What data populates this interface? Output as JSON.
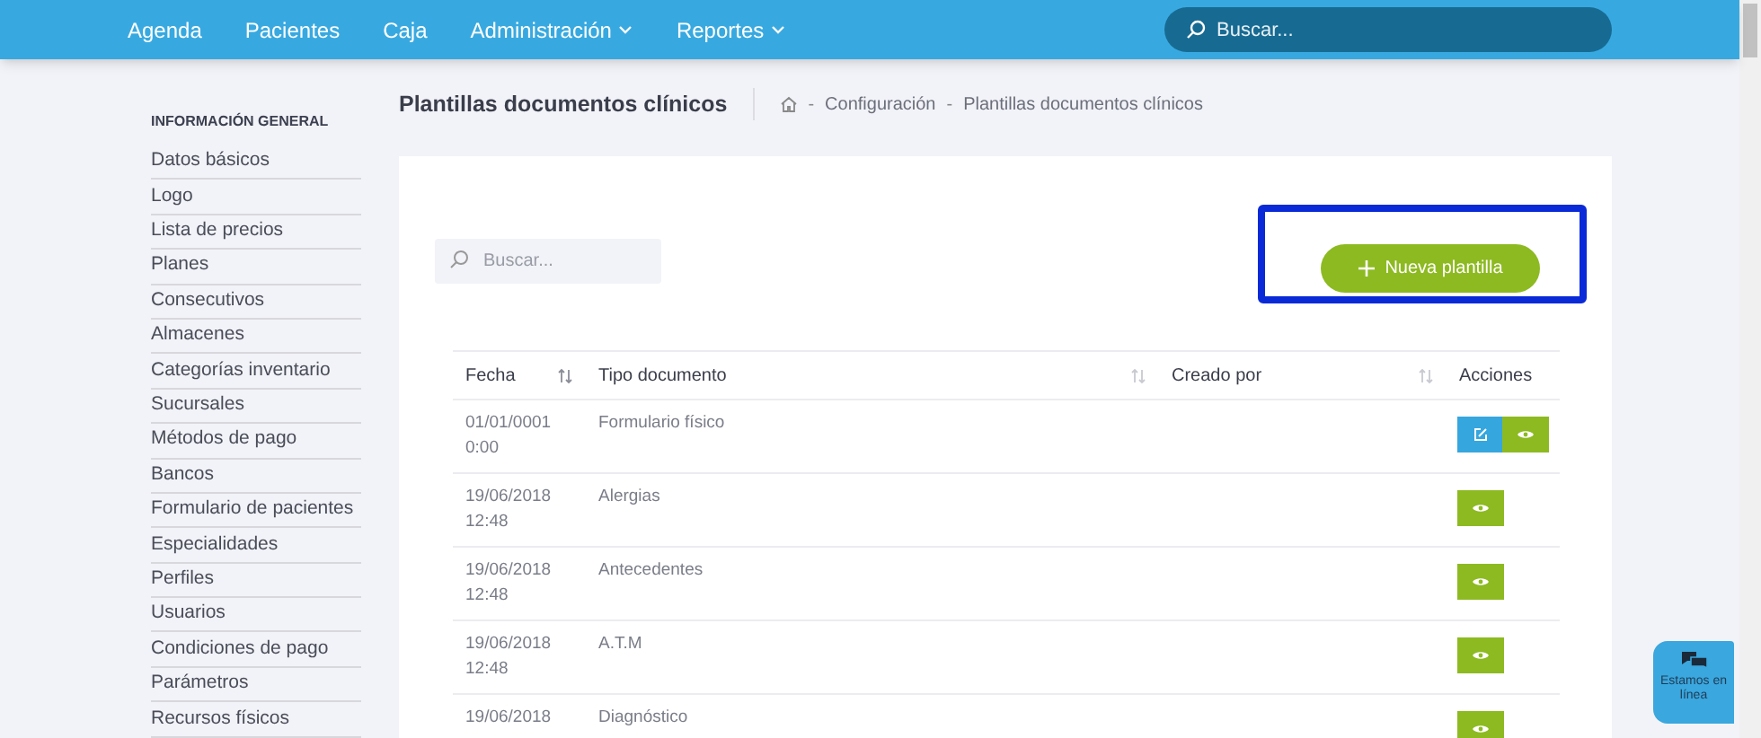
{
  "nav": {
    "items": [
      {
        "label": "Agenda",
        "dropdown": false
      },
      {
        "label": "Pacientes",
        "dropdown": false
      },
      {
        "label": "Caja",
        "dropdown": false
      },
      {
        "label": "Administración",
        "dropdown": true
      },
      {
        "label": "Reportes",
        "dropdown": true
      }
    ],
    "search": {
      "placeholder": "Buscar..."
    }
  },
  "sidebar": {
    "heading": "INFORMACIÓN GENERAL",
    "items": [
      "Datos básicos",
      "Logo",
      "Lista de precios",
      "Planes",
      "Consecutivos",
      "Almacenes",
      "Categorías inventario",
      "Sucursales",
      "Métodos de pago",
      "Bancos",
      "Formulario de pacientes",
      "Especialidades",
      "Perfiles",
      "Usuarios",
      "Condiciones de pago",
      "Parámetros",
      "Recursos físicos"
    ]
  },
  "page": {
    "title": "Plantillas documentos clínicos",
    "separator": "-",
    "breadcrumb": [
      "Configuración",
      "Plantillas documentos clínicos"
    ]
  },
  "card": {
    "search": {
      "placeholder": "Buscar..."
    },
    "new_button": {
      "label": "Nueva plantilla",
      "highlighted": true
    },
    "table": {
      "columns": [
        "Fecha",
        "Tipo documento",
        "Creado por",
        "Acciones"
      ],
      "rows": [
        {
          "date": "01/01/0001",
          "time": "0:00",
          "type": "Formulario físico",
          "actions": [
            {
              "kind": "edit"
            },
            {
              "kind": "view"
            }
          ]
        },
        {
          "date": "19/06/2018",
          "time": "12:48",
          "type": "Alergias",
          "actions": [
            {
              "kind": "view"
            }
          ]
        },
        {
          "date": "19/06/2018",
          "time": "12:48",
          "type": "Antecedentes",
          "actions": [
            {
              "kind": "view"
            }
          ]
        },
        {
          "date": "19/06/2018",
          "time": "12:48",
          "type": "A.T.M",
          "actions": [
            {
              "kind": "view"
            }
          ]
        },
        {
          "date": "19/06/2018",
          "type": "Diagnóstico",
          "actions": [
            {
              "kind": "view"
            }
          ]
        }
      ]
    }
  },
  "chat": {
    "label": "Estamos en línea"
  }
}
